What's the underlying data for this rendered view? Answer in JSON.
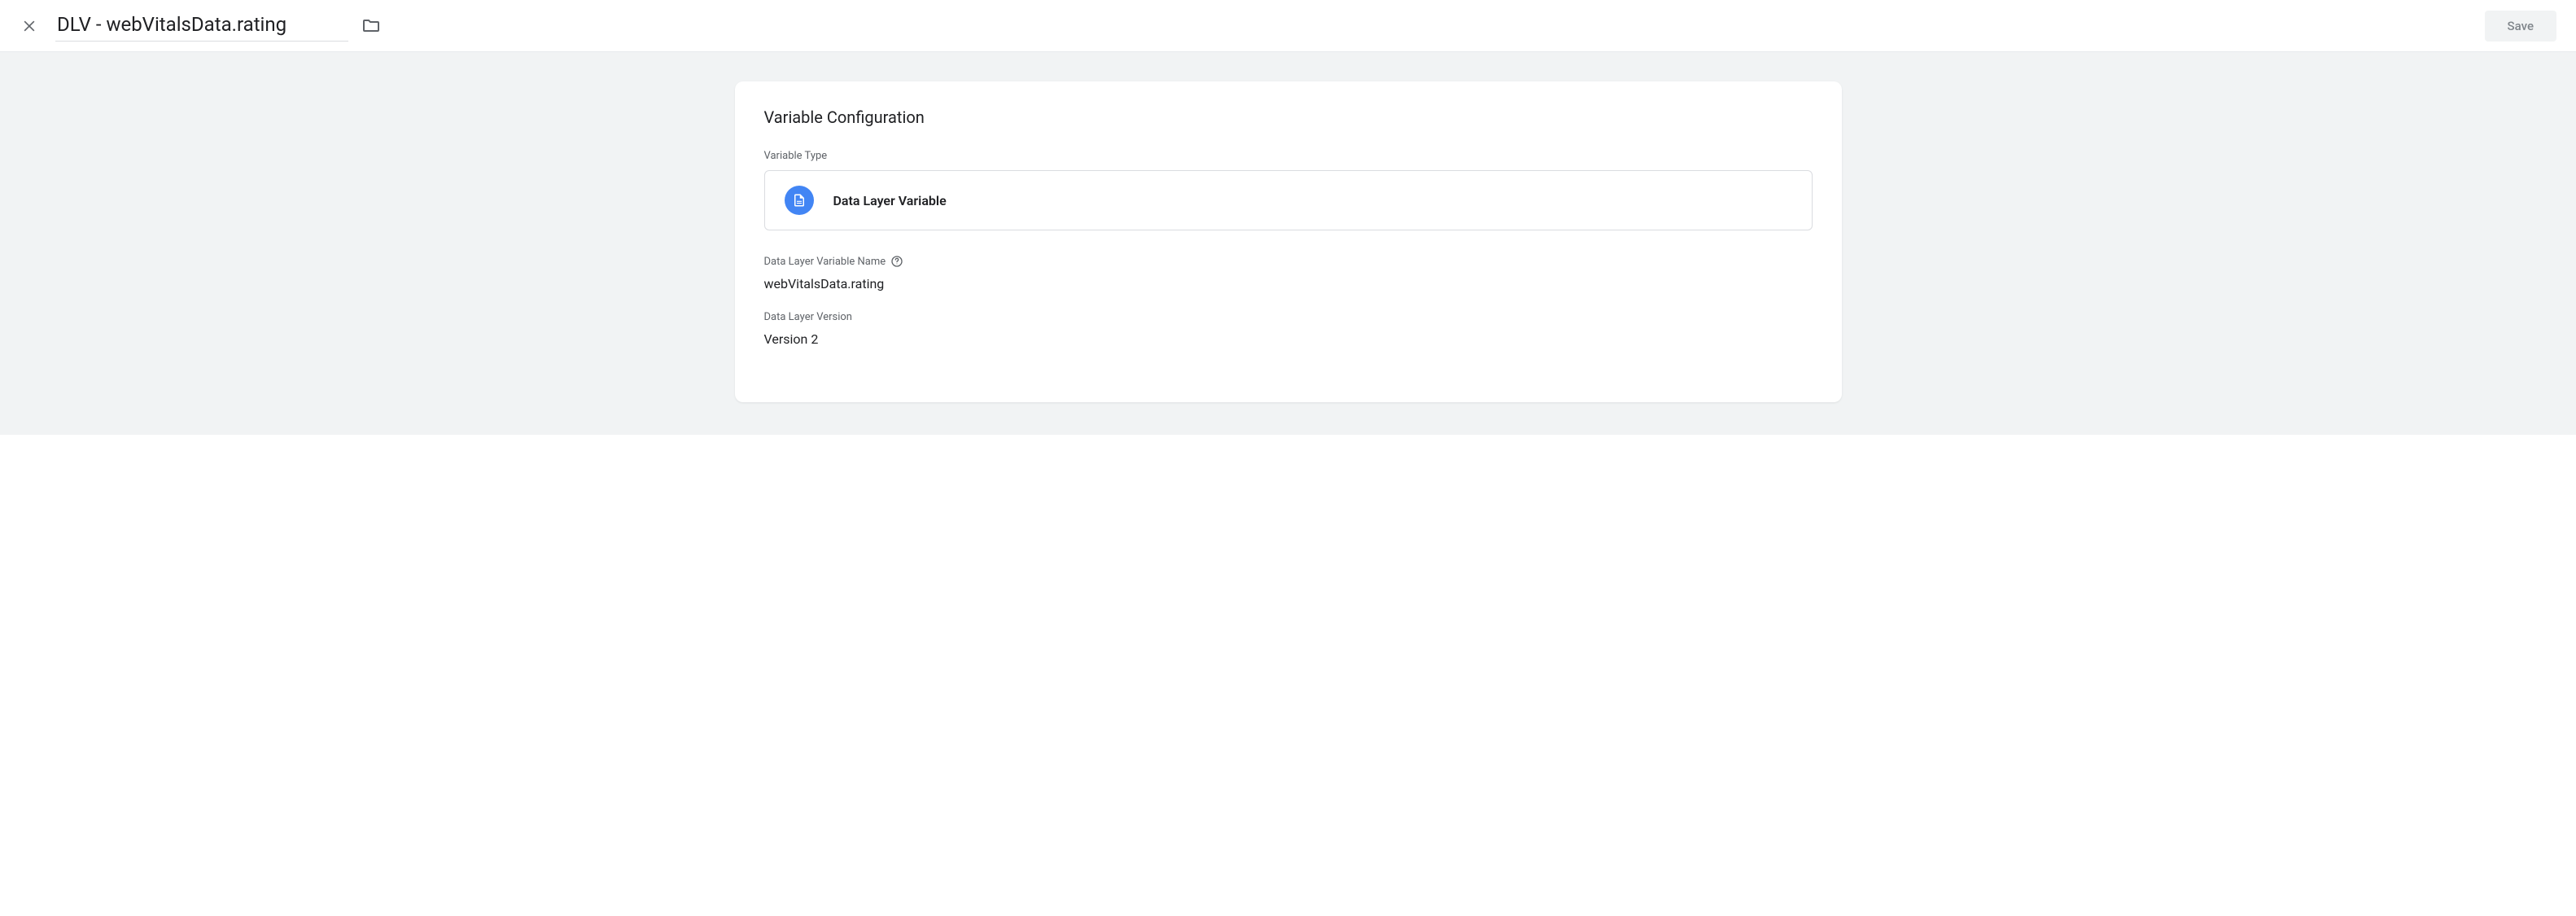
{
  "header": {
    "title": "DLV - webVitalsData.rating",
    "save_label": "Save"
  },
  "card": {
    "heading": "Variable Configuration",
    "variable_type_label": "Variable Type",
    "variable_type_value": "Data Layer Variable",
    "dlv_name_label": "Data Layer Variable Name",
    "dlv_name_value": "webVitalsData.rating",
    "dlv_version_label": "Data Layer Version",
    "dlv_version_value": "Version 2"
  }
}
